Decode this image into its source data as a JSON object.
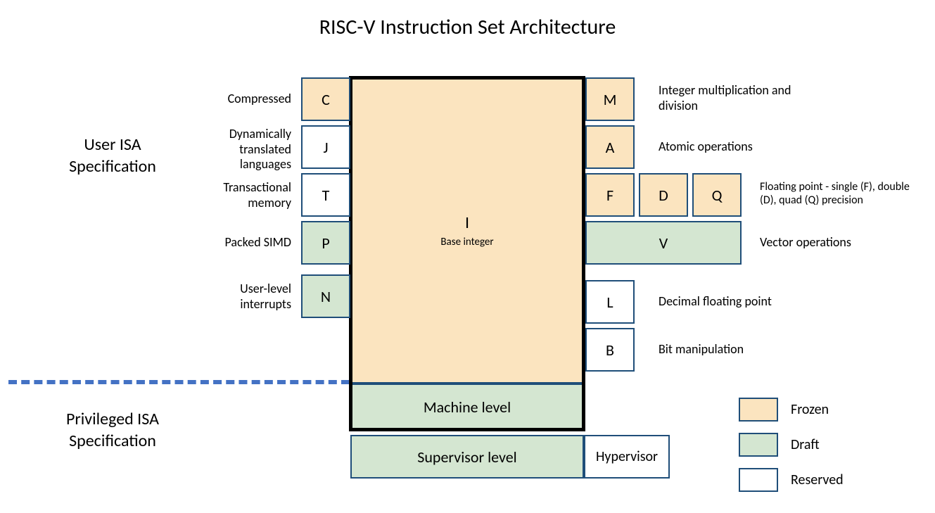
{
  "title": "RISC-V Instruction Set  Architecture",
  "sections": {
    "user_isa": "User ISA Specification",
    "priv_isa": "Privileged ISA Specification"
  },
  "core": {
    "letter": "I",
    "sub": "Base integer"
  },
  "left_boxes": {
    "C": {
      "letter": "C",
      "label": "Compressed"
    },
    "J": {
      "letter": "J",
      "label": "Dynamically translated languages"
    },
    "T": {
      "letter": "T",
      "label": "Transactional memory"
    },
    "P": {
      "letter": "P",
      "label": "Packed SIMD"
    },
    "N": {
      "letter": "N",
      "label": "User-level interrupts"
    }
  },
  "right_boxes": {
    "M": {
      "letter": "M",
      "label": "Integer multiplication and division"
    },
    "A": {
      "letter": "A",
      "label": "Atomic operations"
    },
    "F": {
      "letter": "F"
    },
    "D": {
      "letter": "D"
    },
    "Q": {
      "letter": "Q"
    },
    "FDQ_label": "Floating point - single (F), double (D), quad (Q) precision",
    "V": {
      "letter": "V",
      "label": "Vector operations"
    },
    "L": {
      "letter": "L",
      "label": "Decimal floating point"
    },
    "B": {
      "letter": "B",
      "label": "Bit manipulation"
    }
  },
  "priv_levels": {
    "machine": "Machine level",
    "supervisor": "Supervisor level",
    "hypervisor": "Hypervisor"
  },
  "legend": {
    "frozen": "Frozen",
    "draft": "Draft",
    "reserved": "Reserved"
  },
  "colors": {
    "frozen": "#fbe4bf",
    "draft": "#d4e6d1",
    "reserved": "#ffffff",
    "border": "#1f4e79",
    "dash": "#4472c4"
  }
}
